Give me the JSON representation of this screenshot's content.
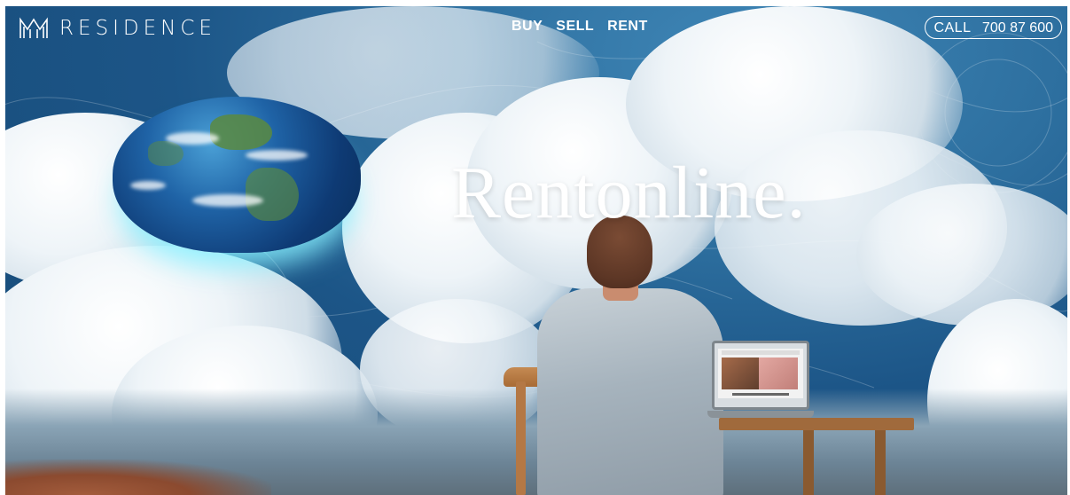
{
  "brand": {
    "name": "RESIDENCE"
  },
  "nav": {
    "items": [
      "BUY",
      "SELL",
      "RENT"
    ]
  },
  "cta": {
    "call_label": "CALL",
    "phone": "700 87 600"
  },
  "hero": {
    "headline": "Rentonline."
  },
  "icons": {
    "logo": "residence-logo-icon"
  },
  "colors": {
    "text": "#ffffff",
    "sky": "#2d6f9f",
    "glow": "#87f0ff"
  }
}
